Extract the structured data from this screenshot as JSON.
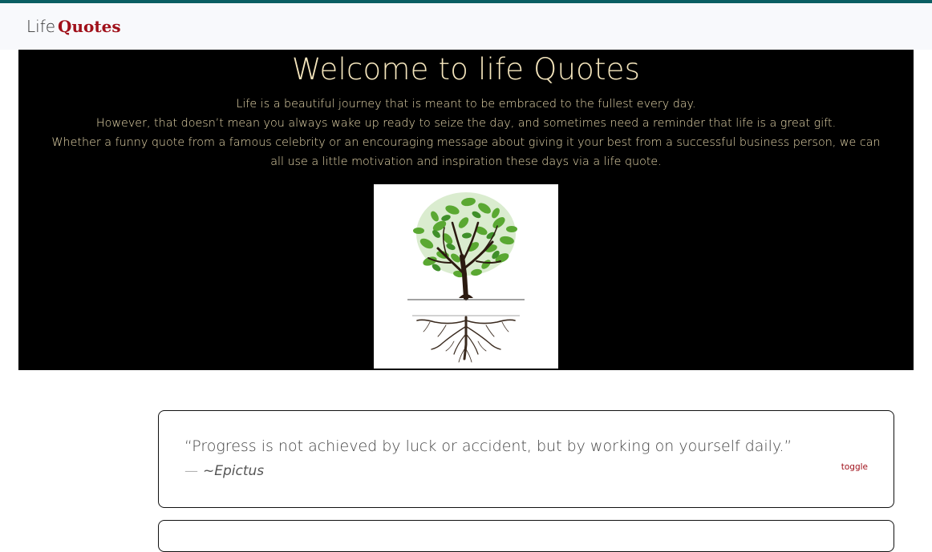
{
  "navbar": {
    "brand_light": "Life",
    "brand_bold": "Quotes",
    "brand_color": "#a0101a",
    "accent_border": "#0b5e63"
  },
  "hero": {
    "title": "Welcome to life Quotes",
    "paragraphs": [
      "Life is a beautiful journey that is meant to be embraced to the fullest every day.",
      "However, that doesn’t mean you always wake up ready to seize the day, and sometimes need a reminder that life is a great gift.",
      "Whether a funny quote from a famous celebrity or an encouraging message about giving it your best from a successful business person, we can all use a little motivation and inspiration these days via a life quote."
    ],
    "image_icon": "tree-with-roots-icon"
  },
  "quotes": [
    {
      "text": "“Progress is not achieved by luck or accident, but by working on yourself daily.”",
      "dash": "—",
      "author": "~Epictus",
      "toggle_label": "toggle"
    }
  ]
}
